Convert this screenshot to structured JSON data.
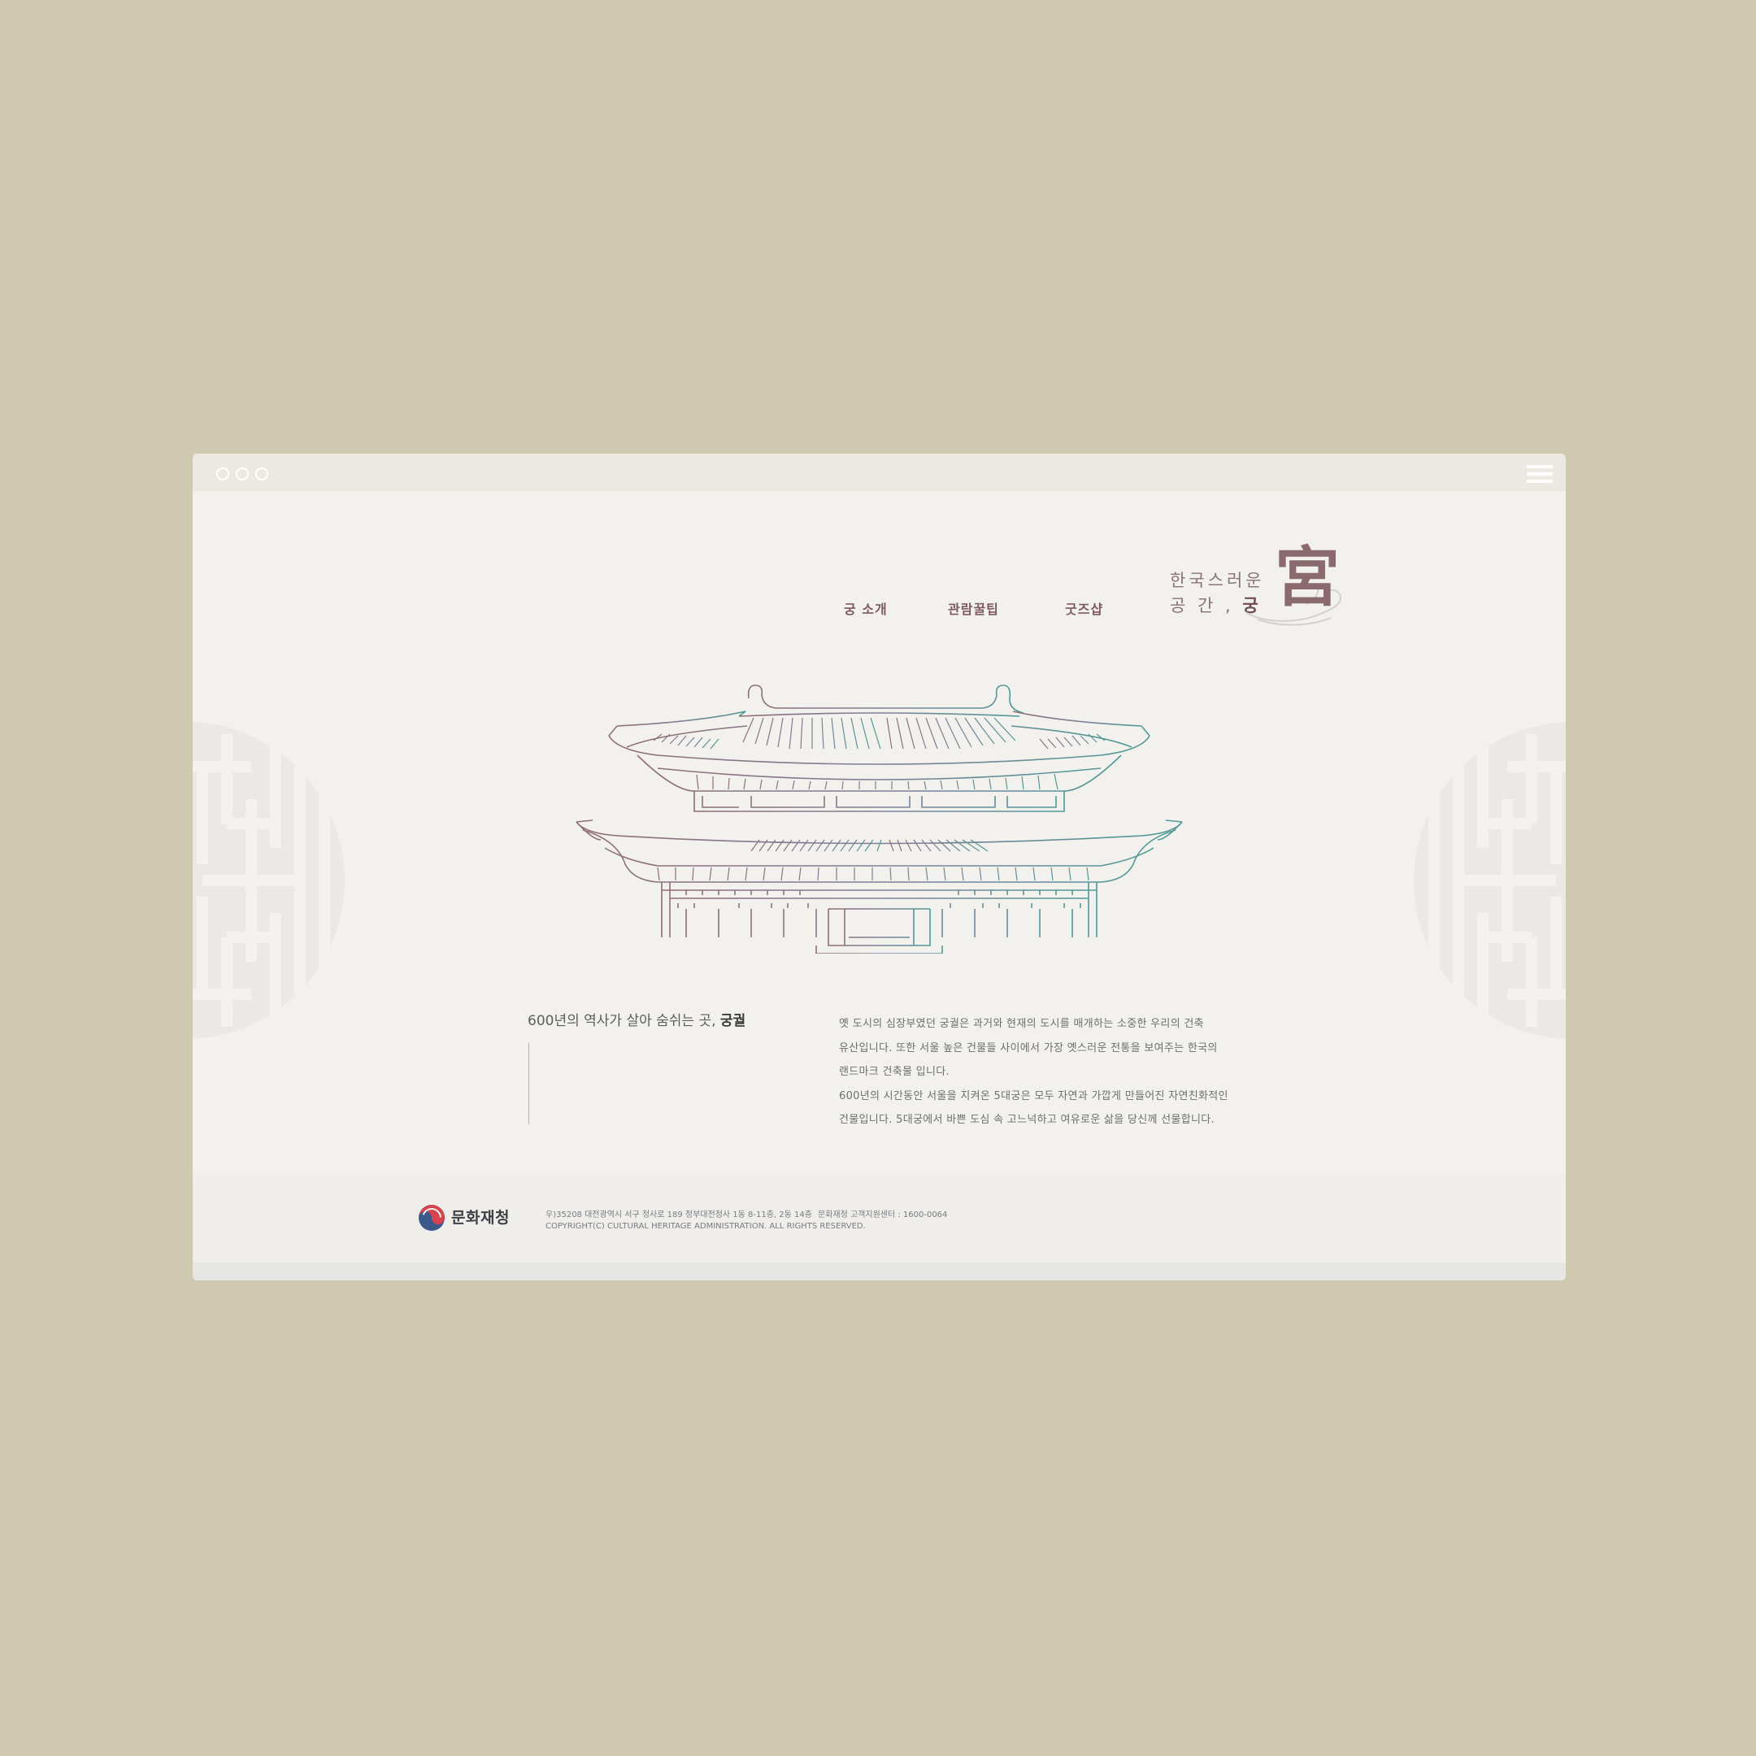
{
  "nav": {
    "items": [
      "궁 소개",
      "관람꿀팁",
      "굿즈샵"
    ]
  },
  "logo": {
    "line1": "한국스러운",
    "line2_prefix": "공 간 ,",
    "line2_bold": "궁",
    "hanja": "宮"
  },
  "intro": {
    "headline_prefix": "600년의 역사가 살아 숨쉬는 곳,",
    "headline_bold": "궁궐",
    "paragraph_lines": [
      " 옛 도시의 심장부였던 궁궐은 과거와 현재의 도시를 매개하는 소중한 우리의 건축",
      "유산입니다.  또한 서울 높은 건물들 사이에서 가장 옛스러운 전통을 보여주는 한국의",
      "랜드마크 건축물 입니다.",
      " 600년의 시간동안 서울을 지켜온 5대궁은 모두 자연과 가깝게 만들어진 자연친화적인",
      "건물입니다. 5대궁에서 바쁜 도심 속 고느넉하고 여유로운 삶을 당신께 선물합니다."
    ]
  },
  "footer": {
    "org_name": "문화재청",
    "address": "우)35208 대전광역시 서구 청사로 189 정부대전청사 1동 8-11층, 2동 14층",
    "contact": "문화재청 고객지원센터 : 1600-0064",
    "copyright": "COPYRIGHT(C) CULTURAL HERITAGE ADMINISTRATION. ALL RIGHTS RESERVED."
  },
  "colors": {
    "background": "#cfc9b2",
    "window": "#f2f1ed",
    "accent": "#7e5a60",
    "line_gradient_start": "#8e6d78",
    "line_gradient_end": "#4e9a97"
  },
  "icons": {
    "window_controls": "three-circle-icons",
    "menu": "hamburger-icon",
    "logo_mark": "taegeuk-icon",
    "decor": "korean-lattice-medallion"
  }
}
